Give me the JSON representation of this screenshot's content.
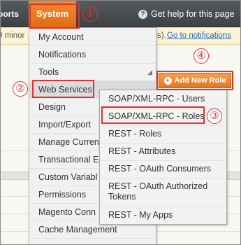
{
  "nav": {
    "reports_label": "ports",
    "system_label": "System",
    "help_label": "Get help for this page"
  },
  "notice": {
    "text_pre": "9 minor",
    "text_post": "s).",
    "link_label": "Go to notifications"
  },
  "add_role_button": {
    "label": "Add New Role"
  },
  "system_menu": {
    "items": [
      {
        "label": "My Account"
      },
      {
        "label": "Notifications"
      },
      {
        "label": "Tools"
      },
      {
        "label": "Web Services"
      },
      {
        "label": "Design"
      },
      {
        "label": "Import/Export"
      },
      {
        "label": "Manage Curren"
      },
      {
        "label": "Transactional E"
      },
      {
        "label": "Custom Variabl"
      },
      {
        "label": "Permissions"
      },
      {
        "label": "Magento Conn"
      },
      {
        "label": "Cache Management"
      }
    ]
  },
  "web_services_submenu": {
    "items": [
      {
        "label": "SOAP/XML-RPC - Users"
      },
      {
        "label": "SOAP/XML-RPC - Roles"
      },
      {
        "label": "REST - Roles"
      },
      {
        "label": "REST - Attributes"
      },
      {
        "label": "REST - OAuth Consumers"
      },
      {
        "label": "REST - OAuth Authorized Tokens"
      },
      {
        "label": "REST - My Apps"
      }
    ]
  },
  "annotations": {
    "step1": "①",
    "step2": "②",
    "step3": "③",
    "step4": "④",
    "color": "#e4312d"
  },
  "colors": {
    "nav_bg": "#3c4144",
    "accent_orange": "#e8741c",
    "link_blue": "#1e6bb8"
  }
}
